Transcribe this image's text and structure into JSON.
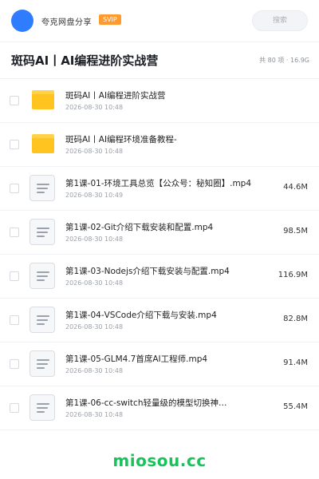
{
  "header": {
    "app_name": "夸克网盘分享",
    "badge": "SVIP",
    "search_placeholder": "搜索"
  },
  "folder": {
    "title": "斑码AI丨AI编程进阶实战营",
    "meta": "共 80 项 · 16.9G"
  },
  "items": [
    {
      "type": "folder",
      "name": "斑码AI丨AI编程进阶实战营",
      "date": "2026-08-30 10:48",
      "size": ""
    },
    {
      "type": "folder",
      "name": "斑码AI丨AI编程环境准备教程-",
      "date": "2026-08-30 10:48",
      "size": ""
    },
    {
      "type": "file",
      "name": "第1课-01-环境工具总览【公众号：秘知圈】.mp4",
      "date": "2026-08-30 10:49",
      "size": "44.6M"
    },
    {
      "type": "file",
      "name": "第1课-02-Git介绍下载安装和配置.mp4",
      "date": "2026-08-30 10:48",
      "size": "98.5M"
    },
    {
      "type": "file",
      "name": "第1课-03-Nodejs介绍下载安装与配置.mp4",
      "date": "2026-08-30 10:48",
      "size": "116.9M"
    },
    {
      "type": "file",
      "name": "第1课-04-VSCode介绍下载与安装.mp4",
      "date": "2026-08-30 10:48",
      "size": "82.8M"
    },
    {
      "type": "file",
      "name": "第1课-05-GLM4.7首席AI工程师.mp4",
      "date": "2026-08-30 10:48",
      "size": "91.4M"
    },
    {
      "type": "file",
      "name": "第1课-06-cc-switch轻量级的模型切换神…",
      "date": "2026-08-30 10:48",
      "size": "55.4M"
    }
  ],
  "watermark": "miosou.cc",
  "colors": {
    "accent": "#2f7cff",
    "badge": "#ff9a2e",
    "folder": "#ffc41f",
    "watermark": "#19c35b"
  }
}
